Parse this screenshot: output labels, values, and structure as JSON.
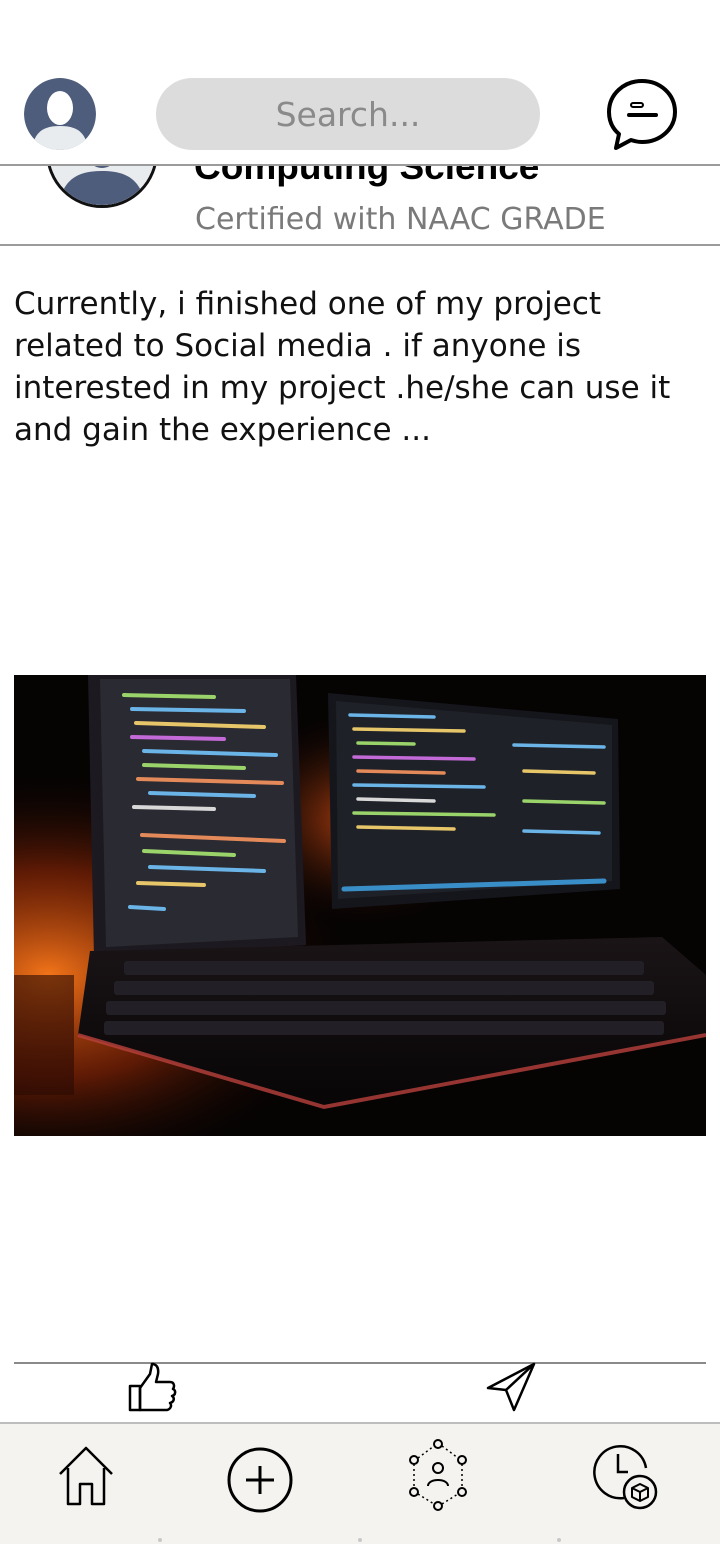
{
  "header": {
    "search_placeholder": "Search..."
  },
  "post": {
    "org_name": "Computing Science",
    "org_subtitle": "Certified with NAAC GRADE",
    "text": "Currently, i finished one of my project related to Social media . if anyone is interested in my project .he/she can use it and gain the experience ..."
  },
  "icons": {
    "profile": "avatar-icon",
    "chat": "chat-bubble-icon",
    "like": "thumbs-up-icon",
    "share": "send-icon",
    "home": "home-icon",
    "add": "plus-circle-icon",
    "network": "people-network-icon",
    "history": "clock-box-icon"
  },
  "colors": {
    "avatar": "#4f5d7c",
    "search_bg": "#dcdcdc",
    "nav_bg": "#f5f3ef",
    "divider": "#9b9b9b"
  }
}
